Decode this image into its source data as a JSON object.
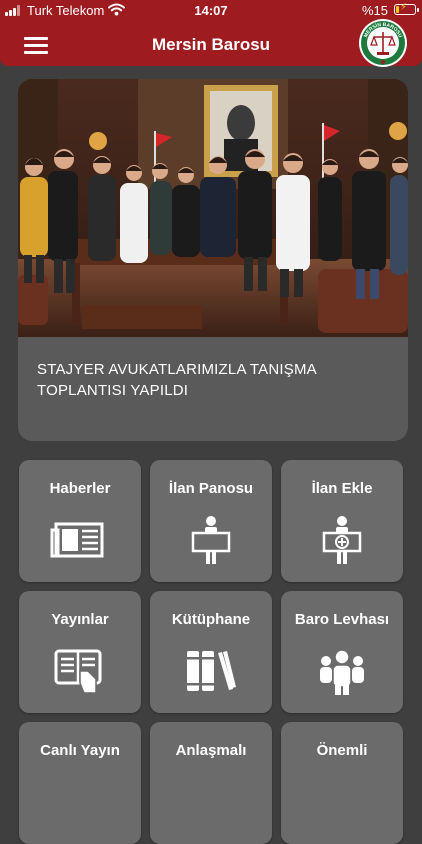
{
  "status_bar": {
    "carrier": "Turk Telekom",
    "time": "14:07",
    "battery": "%15",
    "battery_level": 0.15,
    "wifi_icon": "wifi-icon",
    "signal_icon": "signal-icon"
  },
  "header": {
    "title": "Mersin Barosu",
    "menu_icon": "hamburger-menu-icon",
    "logo_icon": "mersin-barosu-seal",
    "logo_text": "MERSİN BAROSU",
    "color": "#9e1b20"
  },
  "news": {
    "title": "STAJYER AVUKATLARIMIZLA TANIŞMA TOPLANTISI YAPILDI"
  },
  "tiles": [
    {
      "label": "Haberler",
      "icon": "newspaper-icon"
    },
    {
      "label": "İlan Panosu",
      "icon": "person-with-sign-icon"
    },
    {
      "label": "İlan Ekle",
      "icon": "person-with-sign-plus-icon"
    },
    {
      "label": "Yayınlar",
      "icon": "reading-publication-icon"
    },
    {
      "label": "Kütüphane",
      "icon": "books-icon"
    },
    {
      "label": "Baro Levhası",
      "icon": "group-people-icon"
    },
    {
      "label": "Canlı Yayın",
      "icon": "live-broadcast-icon"
    },
    {
      "label": "Anlaşmalı",
      "icon": "agreement-icon"
    },
    {
      "label": "Önemli",
      "icon": "important-icon"
    }
  ]
}
